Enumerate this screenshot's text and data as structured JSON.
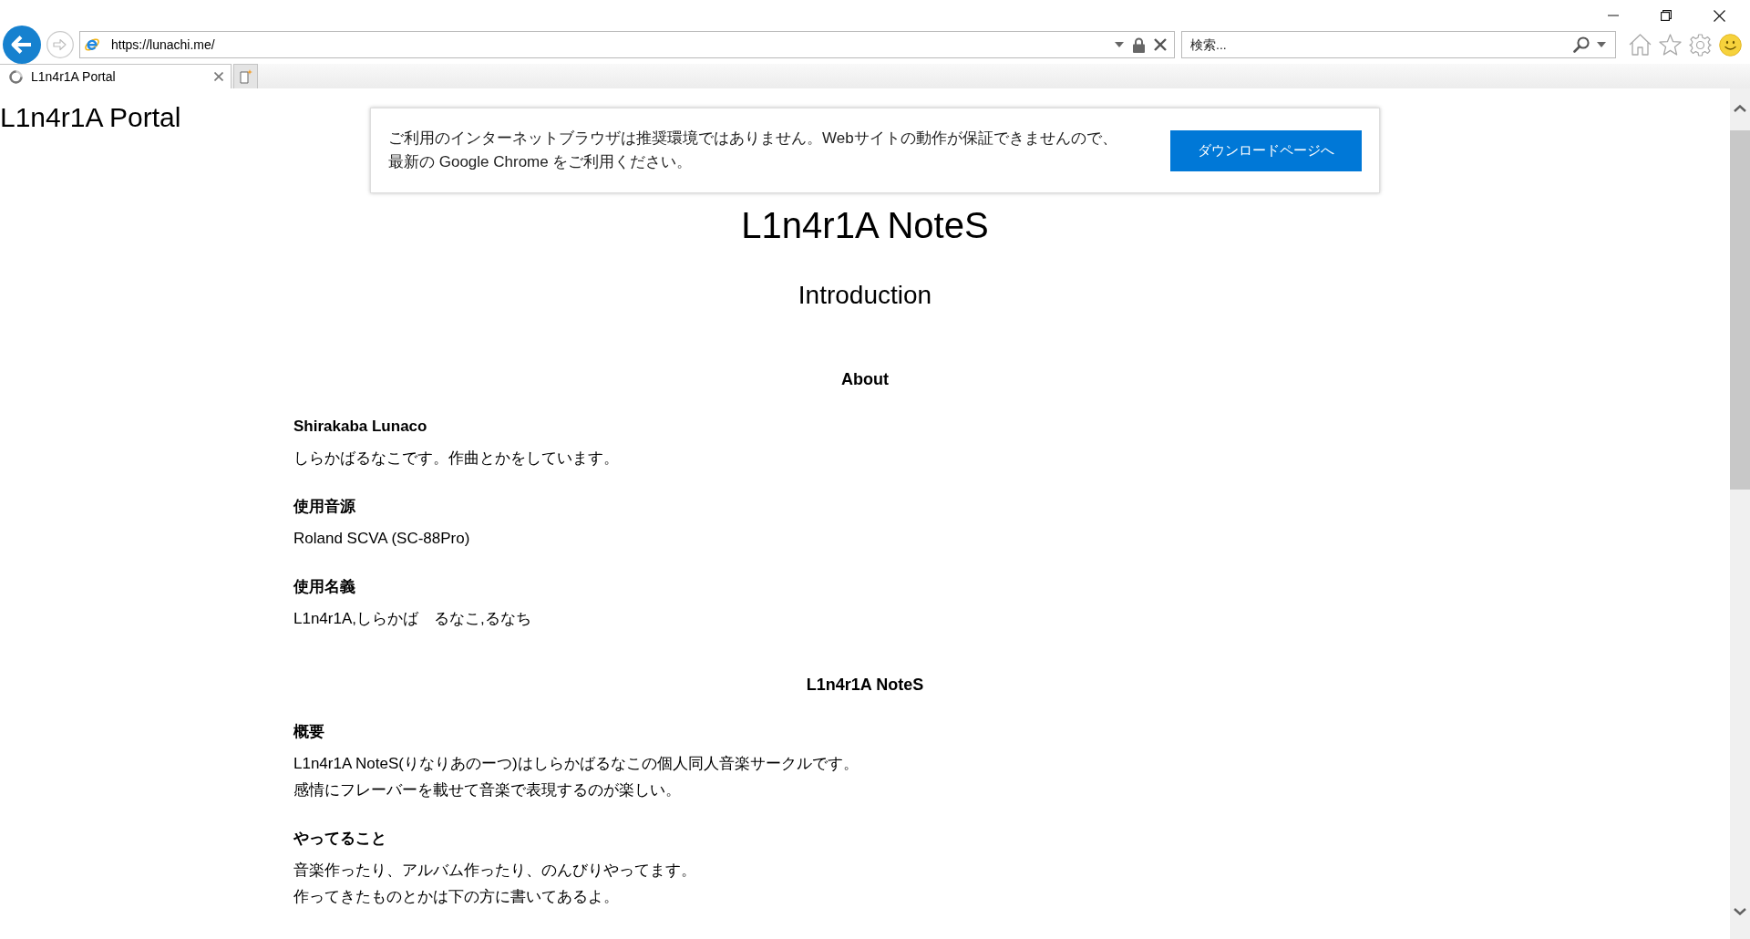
{
  "browser": {
    "address_bar": {
      "url": "https://lunachi.me/"
    },
    "search_box": {
      "placeholder": "検索..."
    },
    "tabs": [
      {
        "label": "L1n4r1A Portal",
        "selected": true
      }
    ]
  },
  "page": {
    "site_title": "L1n4r1A Portal",
    "notice": {
      "lines": [
        "ご利用のインターネットブラウザは推奨環境ではありません。Webサイトの動作が保証できませんので、",
        "最新の Google Chrome をご利用ください。"
      ],
      "button": "ダウンロードページへ"
    },
    "title": "L1n4r1A NoteS",
    "subtitle": "Introduction",
    "sections": [
      {
        "heading": "About",
        "items": [
          {
            "label": "Shirakaba Lunaco",
            "lines": [
              "しらかばるなこです。作曲とかをしています。"
            ]
          },
          {
            "label": "使用音源",
            "lines": [
              "Roland SCVA (SC-88Pro)"
            ]
          },
          {
            "label": "使用名義",
            "lines": [
              "L1n4r1A,しらかば　るなこ,るなち"
            ]
          }
        ]
      },
      {
        "heading": "L1n4r1A NoteS",
        "items": [
          {
            "label": "概要",
            "lines": [
              "L1n4r1A NoteS(りなりあのーつ)はしらかばるなこの個人同人音楽サークルです。",
              "感情にフレーバーを載せて音楽で表現するのが楽しい。"
            ]
          },
          {
            "label": "やってること",
            "lines": [
              "音楽作ったり、アルバム作ったり、のんびりやってます。",
              "作ってきたものとかは下の方に書いてあるよ。"
            ]
          }
        ]
      }
    ]
  }
}
